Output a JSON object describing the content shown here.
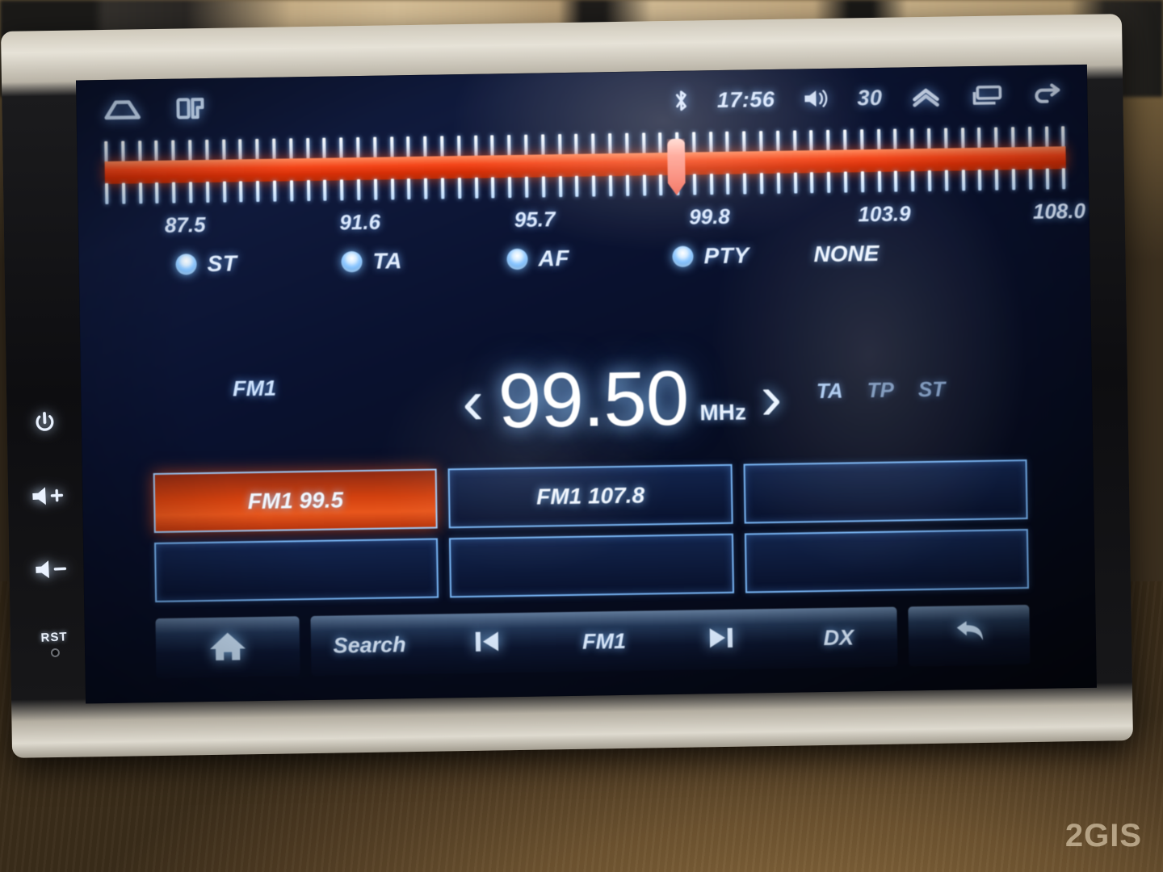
{
  "device": {
    "watermark": "2GIS",
    "side_keys": [
      {
        "name": "power-key",
        "icon": "power-icon"
      },
      {
        "name": "volume-up-key",
        "icon": "volume-up-icon"
      },
      {
        "name": "volume-down-key",
        "icon": "volume-down-icon"
      }
    ],
    "reset_label": "RST"
  },
  "statusbar": {
    "left_icons": [
      {
        "name": "home-icon",
        "label": "home"
      },
      {
        "name": "apps-icon",
        "label": "apps"
      }
    ],
    "bluetooth_icon": "bluetooth-icon",
    "time": "17:56",
    "volume_icon": "volume-icon",
    "volume": "30",
    "right_icons": [
      {
        "name": "chevron-up-icon",
        "label": "expand"
      },
      {
        "name": "recents-icon",
        "label": "recents"
      },
      {
        "name": "back-icon",
        "label": "back"
      }
    ]
  },
  "tuner": {
    "scale_labels": [
      "87.5",
      "91.6",
      "95.7",
      "99.8",
      "103.9",
      "108.0"
    ],
    "scale_min": 87.5,
    "scale_max": 108.0,
    "cursor_frequency": "99.50",
    "bar_color": "#f4461a",
    "cursor_color": "#ff9e8f"
  },
  "rds": {
    "toggles": [
      {
        "label": "ST",
        "on": true
      },
      {
        "label": "TA",
        "on": true
      },
      {
        "label": "AF",
        "on": true
      },
      {
        "label": "PTY",
        "on": true
      }
    ],
    "pty_value": "NONE"
  },
  "display": {
    "band": "FM1",
    "prev_icon": "chevron-left-icon",
    "frequency": "99.50",
    "unit": "MHz",
    "next_icon": "chevron-right-icon",
    "flags": [
      {
        "label": "TA",
        "active": true
      },
      {
        "label": "TP",
        "active": false
      },
      {
        "label": "ST",
        "active": false
      }
    ]
  },
  "presets": [
    {
      "label": "FM1 99.5",
      "active": true
    },
    {
      "label": "FM1 107.8",
      "active": false
    },
    {
      "label": "",
      "active": false
    },
    {
      "label": "",
      "active": false
    },
    {
      "label": "",
      "active": false
    },
    {
      "label": "",
      "active": false
    }
  ],
  "bottombar": {
    "home_icon": "home-filled-icon",
    "search_label": "Search",
    "prev_icon": "skip-previous-icon",
    "band_label": "FM1",
    "next_icon": "skip-next-icon",
    "dx_label": "DX",
    "back_icon": "return-arrow-icon"
  }
}
